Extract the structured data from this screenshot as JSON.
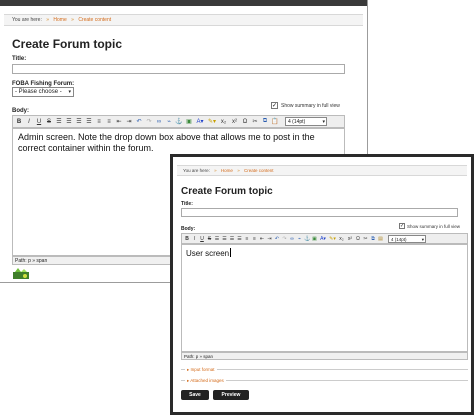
{
  "admin": {
    "breadcrumb": {
      "prefix": "You are here:",
      "home": "Home",
      "current": "Create content"
    },
    "title": "Create Forum topic",
    "title_label": "Title:",
    "forum_label": "FOBA Fishing Forum:",
    "forum_select_value": "- Please choose -",
    "summary_label": "Show summary in full view",
    "body_label": "Body:",
    "font_size_value": "4 (14pt)",
    "body_text": "Admin screen.  Note the drop down box above that allows me to post in the correct container within the forum.",
    "path_text": "Path: p » span"
  },
  "user": {
    "breadcrumb": {
      "prefix": "You are here:",
      "home": "Home",
      "current": "Create content"
    },
    "title": "Create Forum topic",
    "title_label": "Title:",
    "summary_label": "Show summary in full view",
    "body_label": "Body:",
    "font_size_value": "4 (14pt)",
    "body_text": "User screen",
    "path_text": "Path: p » span",
    "input_format": "Input format",
    "attached_images": "Attached images",
    "save_label": "Save",
    "preview_label": "Preview"
  },
  "toolbar": {
    "bold": "B",
    "italic": "I",
    "underline": "U",
    "strike": "S",
    "subscript": "x₂",
    "superscript": "x²",
    "omega": "Ω"
  },
  "colors": {
    "link": "#d46b1a",
    "button": "#222222",
    "frame": "#2a2a2a"
  }
}
